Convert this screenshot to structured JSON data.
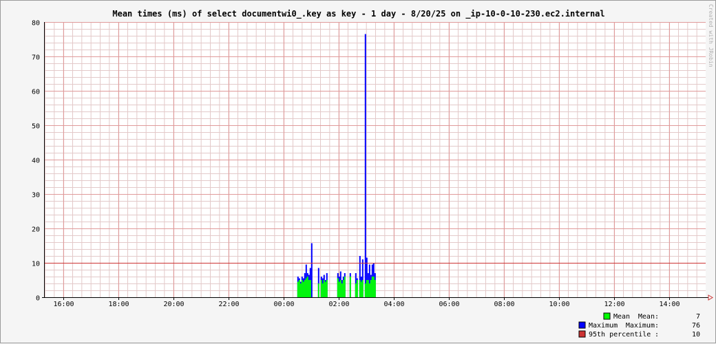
{
  "chart_data": {
    "type": "bar",
    "title": "Mean times (ms) of select documentwi0_.key as key - 1 day - 8/20/25 on _ip-10-0-10-230.ec2.internal",
    "credit": "Created with JRobin",
    "x_ticks": [
      "16:00",
      "18:00",
      "20:00",
      "22:00",
      "00:00",
      "02:00",
      "04:00",
      "06:00",
      "08:00",
      "10:00",
      "12:00",
      "14:00"
    ],
    "y_ticks": [
      "0",
      "10",
      "20",
      "30",
      "40",
      "50",
      "60",
      "70",
      "80"
    ],
    "xlim_hours": [
      15.33,
      15.5
    ],
    "ylim": [
      0,
      80
    ],
    "grid": true,
    "percentile_95": 10,
    "series": [
      {
        "name": "Mean",
        "color": "#00ff00",
        "points": [
          [
            12.5,
            4.5
          ],
          [
            12.55,
            5
          ],
          [
            12.6,
            4
          ],
          [
            12.65,
            5
          ],
          [
            12.7,
            4.5
          ],
          [
            12.75,
            5
          ],
          [
            12.8,
            5.5
          ],
          [
            12.85,
            6
          ],
          [
            12.9,
            5
          ],
          [
            12.95,
            5
          ],
          [
            13.25,
            4
          ],
          [
            13.35,
            5
          ],
          [
            13.4,
            4
          ],
          [
            13.45,
            5
          ],
          [
            13.5,
            4.5
          ],
          [
            13.55,
            5
          ],
          [
            13.95,
            5.5
          ],
          [
            14.0,
            4.5
          ],
          [
            14.05,
            5
          ],
          [
            14.1,
            4
          ],
          [
            14.15,
            5
          ],
          [
            14.2,
            6
          ],
          [
            14.4,
            6
          ],
          [
            14.6,
            4
          ],
          [
            14.65,
            5
          ],
          [
            14.75,
            5
          ],
          [
            14.8,
            4.5
          ],
          [
            14.85,
            5
          ],
          [
            14.95,
            4
          ],
          [
            15.0,
            5
          ],
          [
            15.05,
            5
          ],
          [
            15.1,
            4
          ],
          [
            15.15,
            5
          ],
          [
            15.2,
            6
          ],
          [
            15.25,
            6
          ],
          [
            15.3,
            5
          ]
        ]
      },
      {
        "name": "Maximum",
        "color": "#0000ff",
        "points": [
          [
            12.5,
            6
          ],
          [
            12.55,
            5.5
          ],
          [
            12.6,
            4.5
          ],
          [
            12.65,
            6
          ],
          [
            12.7,
            5.5
          ],
          [
            12.75,
            7
          ],
          [
            12.8,
            9.5
          ],
          [
            12.85,
            7
          ],
          [
            12.9,
            6.5
          ],
          [
            12.95,
            8.5
          ],
          [
            13.0,
            15.7
          ],
          [
            13.25,
            8.5
          ],
          [
            13.35,
            6
          ],
          [
            13.4,
            5.5
          ],
          [
            13.45,
            6.5
          ],
          [
            13.5,
            5
          ],
          [
            13.55,
            7
          ],
          [
            13.95,
            7
          ],
          [
            14.0,
            6
          ],
          [
            14.05,
            7.5
          ],
          [
            14.1,
            5
          ],
          [
            14.15,
            6
          ],
          [
            14.2,
            7
          ],
          [
            14.4,
            7
          ],
          [
            14.6,
            7
          ],
          [
            14.65,
            5.5
          ],
          [
            14.75,
            12
          ],
          [
            14.8,
            6
          ],
          [
            14.85,
            11
          ],
          [
            14.95,
            76.5
          ],
          [
            15.0,
            11.5
          ],
          [
            15.05,
            7
          ],
          [
            15.1,
            9.5
          ],
          [
            15.15,
            6.5
          ],
          [
            15.2,
            9.5
          ],
          [
            15.25,
            10
          ],
          [
            15.3,
            7
          ]
        ]
      }
    ],
    "legend": [
      {
        "swatch_color": "#00ff00",
        "label": "Mean",
        "stat_label": "Mean:",
        "value": "7"
      },
      {
        "swatch_color": "#0000ff",
        "label": "Maximum",
        "stat_label": "Maximum:",
        "value": "76"
      },
      {
        "swatch_color": "#cc3333",
        "label": "95th percentile",
        "stat_label": ":",
        "value": "10"
      }
    ],
    "colors": {
      "background": "#f5f5f5",
      "plot_background": "#ffffff",
      "minor_grid": "#e3c9c9",
      "major_grid": "#e09a9a",
      "axis": "#000000",
      "percentile_line": "#cc3333",
      "arrow": "#cc3333"
    }
  }
}
